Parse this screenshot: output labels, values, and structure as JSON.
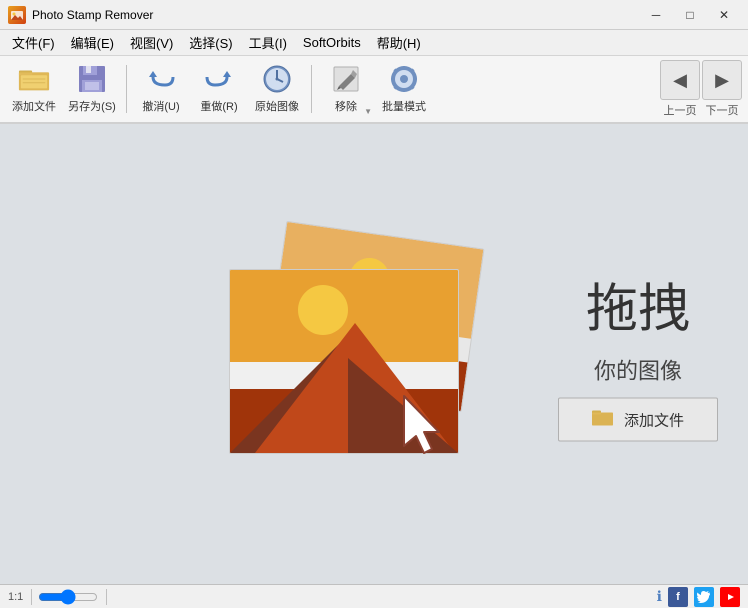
{
  "app": {
    "title": "Photo Stamp Remover",
    "icon": "📷"
  },
  "titlebar": {
    "minimize": "─",
    "maximize": "□",
    "close": "✕"
  },
  "menubar": {
    "items": [
      {
        "id": "file",
        "label": "文件(F)"
      },
      {
        "id": "edit",
        "label": "编辑(E)"
      },
      {
        "id": "view",
        "label": "视图(V)"
      },
      {
        "id": "select",
        "label": "选择(S)"
      },
      {
        "id": "tools",
        "label": "工具(I)"
      },
      {
        "id": "softorbits",
        "label": "SoftOrbits"
      },
      {
        "id": "help",
        "label": "帮助(H)"
      }
    ]
  },
  "toolbar": {
    "buttons": [
      {
        "id": "add-file",
        "label": "添加文件",
        "icon": "folder"
      },
      {
        "id": "save-as",
        "label": "另存为(S)",
        "icon": "save"
      },
      {
        "id": "undo",
        "label": "撤消(U)",
        "icon": "undo"
      },
      {
        "id": "redo",
        "label": "重做(R)",
        "icon": "redo"
      },
      {
        "id": "original",
        "label": "原始图像",
        "icon": "clock"
      },
      {
        "id": "remove",
        "label": "移除",
        "icon": "pencil"
      },
      {
        "id": "batch",
        "label": "批量模式",
        "icon": "gear"
      }
    ],
    "nav": {
      "prev_label": "上一页",
      "next_label": "下一页"
    }
  },
  "dropzone": {
    "main_text": "拖拽",
    "sub_text": "你的图像",
    "button_label": "添加文件"
  },
  "statusbar": {
    "zoom": "1:1",
    "info_icon": "ℹ",
    "social": {
      "facebook": "f",
      "twitter": "t",
      "youtube": "▶"
    }
  }
}
